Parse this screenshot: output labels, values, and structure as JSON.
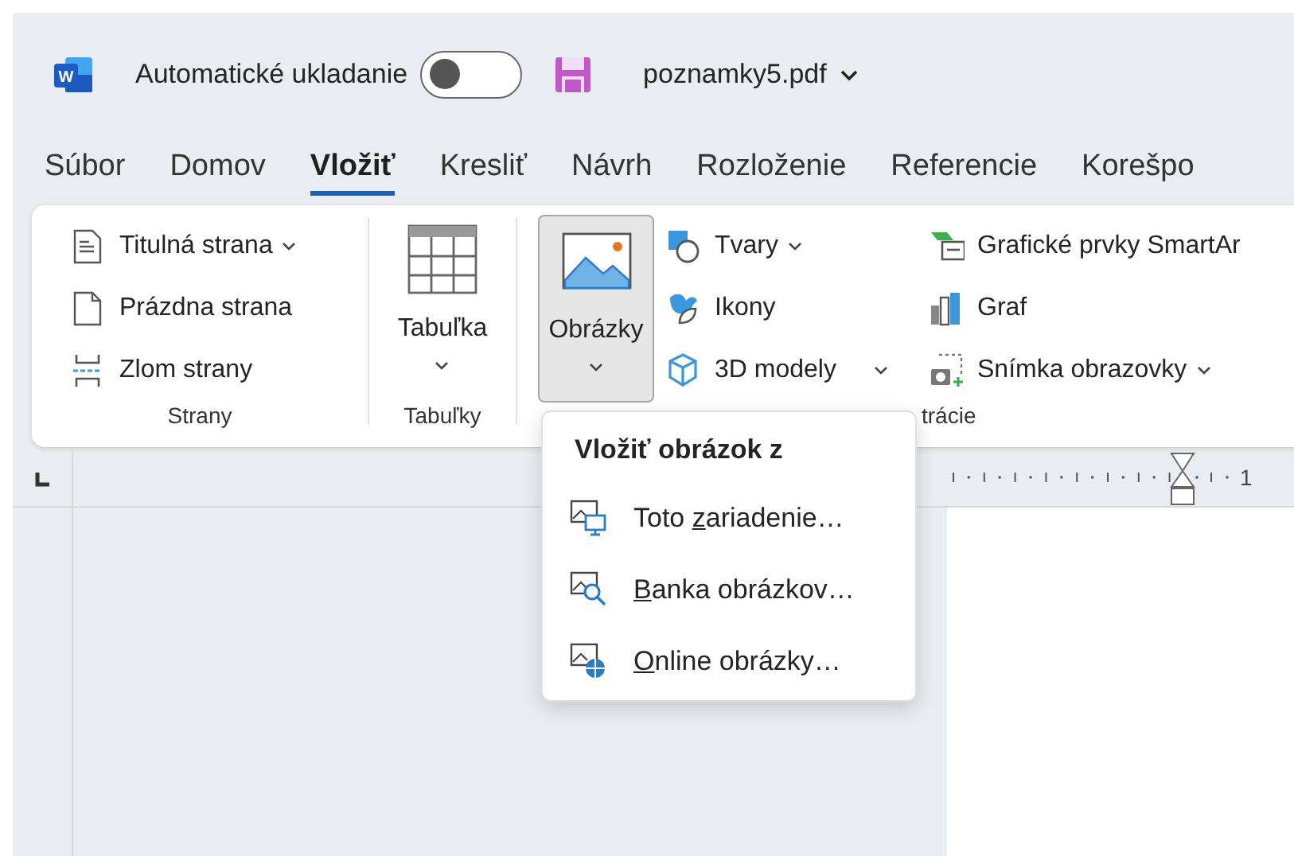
{
  "title_bar": {
    "autosave_label": "Automatické ukladanie",
    "autosave_on": false,
    "filename": "poznamky5.pdf",
    "logo_letter": "W"
  },
  "tabs": [
    {
      "label": "Súbor",
      "selected": false
    },
    {
      "label": "Domov",
      "selected": false
    },
    {
      "label": "Vložiť",
      "selected": true
    },
    {
      "label": "Kresliť",
      "selected": false
    },
    {
      "label": "Návrh",
      "selected": false
    },
    {
      "label": "Rozloženie",
      "selected": false
    },
    {
      "label": "Referencie",
      "selected": false
    },
    {
      "label": "Korešpo",
      "selected": false
    }
  ],
  "ribbon": {
    "pages_group": {
      "label": "Strany",
      "commands": [
        {
          "label": "Titulná strana",
          "dropdown": true
        },
        {
          "label": "Prázdna strana",
          "dropdown": false
        },
        {
          "label": "Zlom strany",
          "dropdown": false
        }
      ]
    },
    "tables_group": {
      "label": "Tabuľky",
      "command": {
        "label": "Tabuľka",
        "dropdown": true
      }
    },
    "illustrations_group": {
      "label": "trácie",
      "pictures_button": {
        "label": "Obrázky",
        "dropdown": true,
        "pressed": true
      },
      "commands": [
        {
          "label": "Tvary",
          "dropdown": true
        },
        {
          "label": "Ikony",
          "dropdown": false
        },
        {
          "label": "3D modely",
          "dropdown": true
        }
      ],
      "commands_2": [
        {
          "label": "Grafické prvky SmartAr",
          "dropdown": false
        },
        {
          "label": "Graf",
          "dropdown": false
        },
        {
          "label": "Snímka obrazovky",
          "dropdown": true
        }
      ]
    }
  },
  "ruler": {
    "number": "1"
  },
  "menu": {
    "title": "Vložiť obrázok z",
    "items": [
      {
        "before": "Toto ",
        "key": "z",
        "after": "ariadenie…"
      },
      {
        "key": "B",
        "after": "anka obrázkov…"
      },
      {
        "key": "O",
        "after": "nline obrázky…"
      }
    ]
  }
}
